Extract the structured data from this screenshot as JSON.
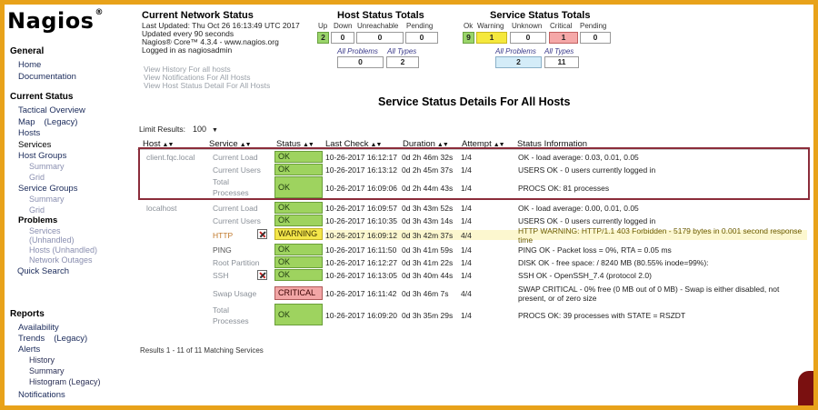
{
  "app": {
    "logo": "Nagios",
    "logo_mark": "®"
  },
  "sidebar": {
    "general_heading": "General",
    "home": "Home",
    "documentation": "Documentation",
    "current_status_heading": "Current Status",
    "tactical_overview": "Tactical Overview",
    "map": "Map",
    "map_legacy": "(Legacy)",
    "hosts": "Hosts",
    "services": "Services",
    "host_groups": "Host Groups",
    "host_groups_summary": "Summary",
    "host_groups_grid": "Grid",
    "service_groups": "Service Groups",
    "service_groups_summary": "Summary",
    "service_groups_grid": "Grid",
    "problems": "Problems",
    "problems_services": "Services",
    "problems_services_unhandled": "(Unhandled)",
    "problems_hosts": "Hosts (Unhandled)",
    "problems_network": "Network Outages",
    "quick_search": "Quick Search",
    "reports_heading": "Reports",
    "availability": "Availability",
    "trends": "Trends",
    "trends_legacy": "(Legacy)",
    "alerts": "Alerts",
    "alerts_history": "History",
    "alerts_summary": "Summary",
    "alerts_histogram": "Histogram (Legacy)",
    "notifications": "Notifications"
  },
  "header": {
    "network_status_title": "Current Network Status",
    "last_updated": "Last Updated: Thu Oct 26 16:13:49 UTC 2017",
    "update_interval": "Updated every 90 seconds",
    "version": "Nagios® Core™ 4.3.4 - www.nagios.org",
    "logged_in": "Logged in as nagiosadmin",
    "link_history": "View History For all hosts",
    "link_notifications": "View Notifications For All Hosts",
    "link_host_detail": "View Host Status Detail For All Hosts"
  },
  "host_totals": {
    "title": "Host Status Totals",
    "headers": [
      "Up",
      "Down",
      "Unreachable",
      "Pending"
    ],
    "values": [
      "2",
      "0",
      "0",
      "0"
    ],
    "all_problems_label": "All Problems",
    "all_types_label": "All Types",
    "all_problems": "0",
    "all_types": "2"
  },
  "service_totals": {
    "title": "Service Status Totals",
    "headers": [
      "Ok",
      "Warning",
      "Unknown",
      "Critical",
      "Pending"
    ],
    "values": [
      "9",
      "1",
      "0",
      "1",
      "0"
    ],
    "all_problems_label": "All Problems",
    "all_types_label": "All Types",
    "all_problems": "2",
    "all_types": "11"
  },
  "main": {
    "title": "Service Status Details For All Hosts",
    "limit_label": "Limit Results:",
    "limit_value": "100",
    "columns": [
      "Host",
      "Service",
      "Status",
      "Last Check",
      "Duration",
      "Attempt",
      "Status Information"
    ],
    "rows": [
      {
        "host": "client.fqc.local",
        "service": "Current Load",
        "status": "OK",
        "last_check": "10-26-2017 16:12:17",
        "duration": "0d 2h 46m 32s",
        "attempt": "1/4",
        "info": "OK - load average: 0.03, 0.01, 0.05"
      },
      {
        "host": "",
        "service": "Current Users",
        "status": "OK",
        "last_check": "10-26-2017 16:13:12",
        "duration": "0d 2h 45m 37s",
        "attempt": "1/4",
        "info": "USERS OK - 0 users currently logged in"
      },
      {
        "host": "",
        "service": "Total Processes",
        "status": "OK",
        "last_check": "10-26-2017 16:09:06",
        "duration": "0d 2h 44m 43s",
        "attempt": "1/4",
        "info": "PROCS OK: 81 processes"
      },
      {
        "host": "localhost",
        "service": "Current Load",
        "status": "OK",
        "last_check": "10-26-2017 16:09:57",
        "duration": "0d 3h 43m 52s",
        "attempt": "1/4",
        "info": "OK - load average: 0.00, 0.01, 0.05"
      },
      {
        "host": "",
        "service": "Current Users",
        "status": "OK",
        "last_check": "10-26-2017 16:10:35",
        "duration": "0d 3h 43m 14s",
        "attempt": "1/4",
        "info": "USERS OK - 0 users currently logged in"
      },
      {
        "host": "",
        "service": "HTTP",
        "status": "WARNING",
        "last_check": "10-26-2017 16:09:12",
        "duration": "0d 3h 42m 37s",
        "attempt": "4/4",
        "info": "HTTP WARNING: HTTP/1.1 403 Forbidden - 5179 bytes in 0.001 second response time"
      },
      {
        "host": "",
        "service": "PING",
        "status": "OK",
        "last_check": "10-26-2017 16:11:50",
        "duration": "0d 3h 41m 59s",
        "attempt": "1/4",
        "info": "PING OK - Packet loss = 0%, RTA = 0.05 ms"
      },
      {
        "host": "",
        "service": "Root Partition",
        "status": "OK",
        "last_check": "10-26-2017 16:12:27",
        "duration": "0d 3h 41m 22s",
        "attempt": "1/4",
        "info": "DISK OK - free space: / 8240 MB (80.55% inode=99%):"
      },
      {
        "host": "",
        "service": "SSH",
        "status": "OK",
        "last_check": "10-26-2017 16:13:05",
        "duration": "0d 3h 40m 44s",
        "attempt": "1/4",
        "info": "SSH OK - OpenSSH_7.4 (protocol 2.0)"
      },
      {
        "host": "",
        "service": "Swap Usage",
        "status": "CRITICAL",
        "last_check": "10-26-2017 16:11:42",
        "duration": "0d 3h 46m 7s",
        "attempt": "4/4",
        "info": "SWAP CRITICAL - 0% free (0 MB out of 0 MB) - Swap is either disabled, not present, or of zero size"
      },
      {
        "host": "",
        "service": "Total Processes",
        "status": "OK",
        "last_check": "10-26-2017 16:09:20",
        "duration": "0d 3h 35m 29s",
        "attempt": "1/4",
        "info": "PROCS OK: 39 processes with STATE = RSZDT"
      }
    ],
    "results_footer": "Results 1 - 11 of 11 Matching Services"
  }
}
